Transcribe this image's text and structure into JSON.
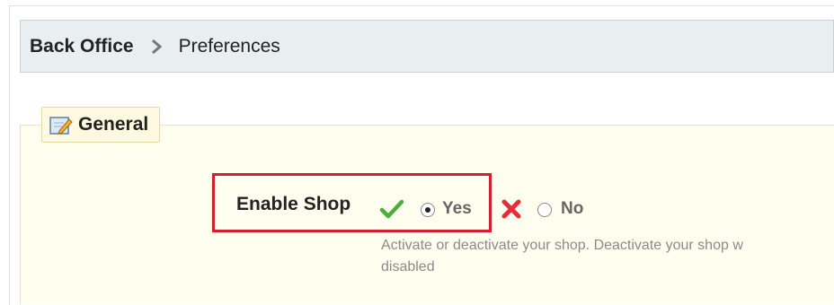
{
  "breadcrumb": {
    "root": "Back Office",
    "separator_icon": "chevron-right-icon",
    "current": "Preferences"
  },
  "section": {
    "legend_icon": "edit-note-icon",
    "legend": "General"
  },
  "field": {
    "label": "Enable Shop",
    "yes_icon": "checkmark-icon",
    "yes_label": "Yes",
    "no_icon": "cross-icon",
    "no_label": "No",
    "selected": "Yes",
    "help_line1": "Activate or deactivate your shop. Deactivate your shop w",
    "help_line2": "disabled"
  },
  "colors": {
    "highlight": "#d3212b",
    "breadcrumb_bg": "#e9eef0",
    "fieldset_bg": "#fffff0",
    "check_green": "#4caf3c",
    "cross_red": "#e0303a"
  }
}
